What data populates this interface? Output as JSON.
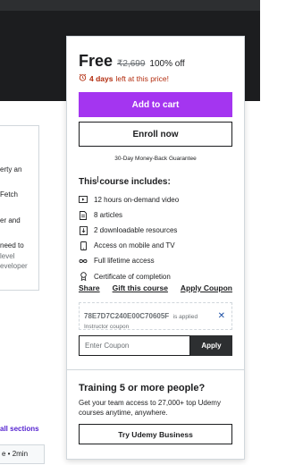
{
  "purchase_card": {
    "price": "Free",
    "original_price": "₹2,699",
    "discount": "100% off",
    "timer_days": "4 days",
    "timer_rest": "left at this price!",
    "add_to_cart": "Add to cart",
    "enroll_now": "Enroll now",
    "guarantee": "30-Day Money-Back Guarantee",
    "includes_title": "This course includes:",
    "includes": [
      {
        "icon": "video-icon",
        "label": "12 hours on-demand video"
      },
      {
        "icon": "article-icon",
        "label": "8 articles"
      },
      {
        "icon": "download-icon",
        "label": "2 downloadable resources"
      },
      {
        "icon": "mobile-icon",
        "label": "Access on mobile and TV"
      },
      {
        "icon": "infinity-icon",
        "label": "Full lifetime access"
      },
      {
        "icon": "certificate-icon",
        "label": "Certificate of completion"
      }
    ],
    "share": "Share",
    "gift": "Gift this course",
    "apply_coupon": "Apply Coupon",
    "coupon_code": "78E7D7C240E00C70605F",
    "coupon_applied": "is applied",
    "coupon_sub": "Instructor coupon",
    "coupon_placeholder": "Enter Coupon",
    "coupon_apply": "Apply"
  },
  "business": {
    "title": "Training 5 or more people?",
    "description": "Get your team access to 27,000+ top Udemy courses anytime, anywhere.",
    "button": "Try Udemy Business"
  },
  "left_fragments": {
    "lines": [
      "erty an",
      "Fetch",
      "er and",
      "need to",
      "level",
      "eveloper"
    ],
    "all_sections": "all sections",
    "lecture_meta": "e • 2min"
  }
}
